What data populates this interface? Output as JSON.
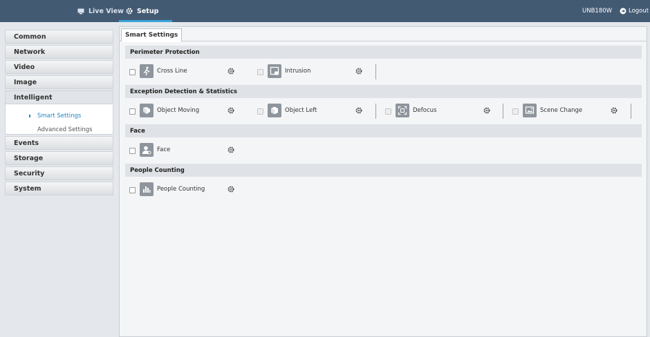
{
  "topnav": {
    "live_view": "Live View",
    "setup": "Setup",
    "device": "UNB180W",
    "logout": "Logout"
  },
  "sidebar": {
    "items": [
      "Common",
      "Network",
      "Video",
      "Image",
      "Intelligent",
      "Events",
      "Storage",
      "Security",
      "System"
    ],
    "sub_items": [
      "Smart Settings",
      "Advanced Settings"
    ]
  },
  "main": {
    "tab": "Smart Settings",
    "sections": [
      {
        "title": "Perimeter Protection",
        "features": [
          {
            "label": "Cross Line",
            "icon": "person-running-icon"
          },
          {
            "label": "Intrusion",
            "icon": "intrusion-icon"
          }
        ]
      },
      {
        "title": "Exception Detection & Statistics",
        "features": [
          {
            "label": "Object Moving",
            "icon": "object-moving-icon"
          },
          {
            "label": "Object Left",
            "icon": "object-left-icon"
          },
          {
            "label": "Defocus",
            "icon": "defocus-icon"
          },
          {
            "label": "Scene Change",
            "icon": "scene-change-icon"
          }
        ]
      },
      {
        "title": "Face",
        "features": [
          {
            "label": "Face",
            "icon": "face-icon"
          }
        ]
      },
      {
        "title": "People Counting",
        "features": [
          {
            "label": "People Counting",
            "icon": "people-counting-icon"
          }
        ]
      }
    ]
  }
}
